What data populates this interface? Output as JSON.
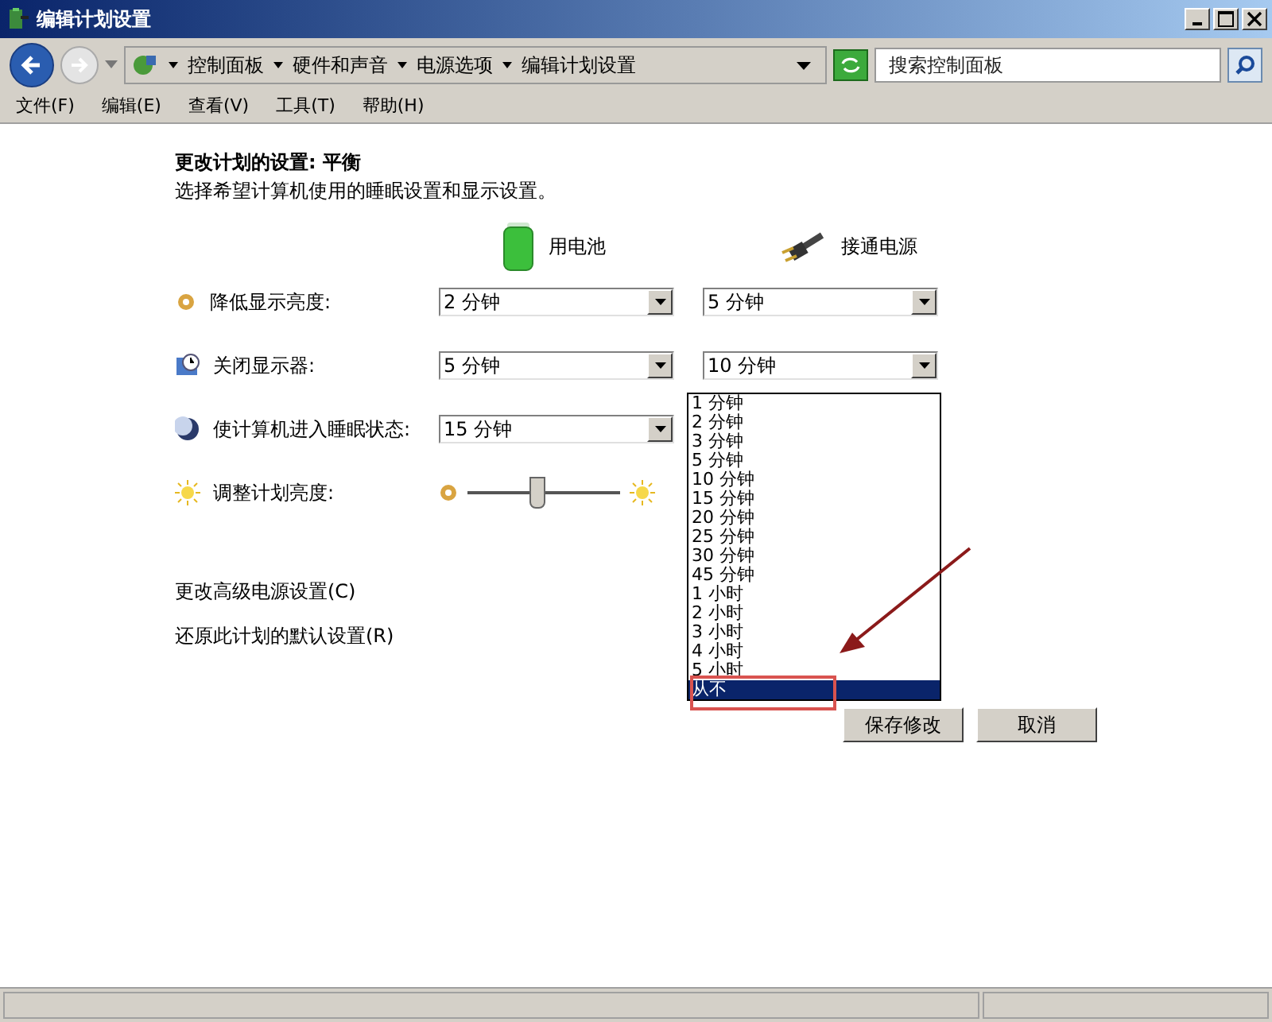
{
  "window": {
    "title": "编辑计划设置"
  },
  "address_bar": {
    "breadcrumbs": [
      "控制面板",
      "硬件和声音",
      "电源选项",
      "编辑计划设置"
    ]
  },
  "search": {
    "placeholder": "搜索控制面板"
  },
  "menu": [
    "文件(F)",
    "编辑(E)",
    "查看(V)",
    "工具(T)",
    "帮助(H)"
  ],
  "heading": "更改计划的设置: 平衡",
  "subtitle": "选择希望计算机使用的睡眠设置和显示设置。",
  "columns": [
    {
      "kind": "battery",
      "label": "用电池"
    },
    {
      "kind": "plug",
      "label": "接通电源"
    }
  ],
  "settings": [
    {
      "kind": "dim",
      "label": "降低显示亮度:",
      "values": [
        "2 分钟",
        "5 分钟"
      ]
    },
    {
      "kind": "display_off",
      "label": "关闭显示器:",
      "values": [
        "5 分钟",
        "10 分钟"
      ]
    },
    {
      "kind": "sleep",
      "label": "使计算机进入睡眠状态:",
      "values": [
        "15 分钟"
      ]
    },
    {
      "kind": "brightness",
      "label": "调整计划亮度:",
      "level": 0.45
    }
  ],
  "open_list": {
    "items": [
      {
        "label": "1 分钟",
        "selected": false
      },
      {
        "label": "2 分钟",
        "selected": false
      },
      {
        "label": "3 分钟",
        "selected": false
      },
      {
        "label": "5 分钟",
        "selected": false
      },
      {
        "label": "10 分钟",
        "selected": false
      },
      {
        "label": "15 分钟",
        "selected": false
      },
      {
        "label": "20 分钟",
        "selected": false
      },
      {
        "label": "25 分钟",
        "selected": false
      },
      {
        "label": "30 分钟",
        "selected": false
      },
      {
        "label": "45 分钟",
        "selected": false
      },
      {
        "label": "1 小时",
        "selected": false
      },
      {
        "label": "2 小时",
        "selected": false
      },
      {
        "label": "3 小时",
        "selected": false
      },
      {
        "label": "4 小时",
        "selected": false
      },
      {
        "label": "5 小时",
        "selected": false
      },
      {
        "label": "从不",
        "selected": true
      }
    ]
  },
  "links": [
    "更改高级电源设置(C)",
    "还原此计划的默认设置(R)"
  ],
  "buttons": [
    "保存修改",
    "取消"
  ]
}
